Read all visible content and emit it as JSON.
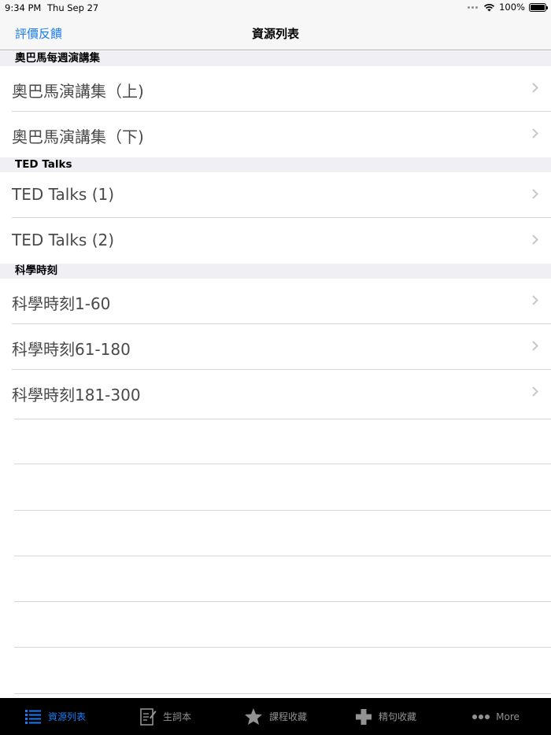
{
  "status": {
    "time": "9:34 PM",
    "date": "Thu Sep 27",
    "battery": "100%",
    "battery_level": 1.0
  },
  "nav": {
    "left_button": "評價反饋",
    "title": "資源列表"
  },
  "sections": [
    {
      "header": "奧巴馬每週演講集",
      "rows": [
        "奧巴馬演講集（上)",
        "奧巴馬演講集（下)"
      ]
    },
    {
      "header": "TED Talks",
      "rows": [
        "TED Talks (1)",
        "TED Talks (2)"
      ]
    },
    {
      "header": "科學時刻",
      "rows": [
        "科學時刻1-60",
        "科學時刻61-180",
        "科學時刻181-300"
      ]
    }
  ],
  "tabs": [
    {
      "label": "資源列表",
      "icon": "list-icon",
      "active": true
    },
    {
      "label": "生詞本",
      "icon": "notebook-icon",
      "active": false
    },
    {
      "label": "課程收藏",
      "icon": "star-icon",
      "active": false
    },
    {
      "label": "精句收藏",
      "icon": "plus-icon",
      "active": false
    },
    {
      "label": "More",
      "icon": "more-icon",
      "active": false
    }
  ],
  "colors": {
    "accent": "#1a7cf4",
    "tab_bar": "#000000",
    "tab_inactive": "#929292",
    "section_header": "#efeff4"
  }
}
